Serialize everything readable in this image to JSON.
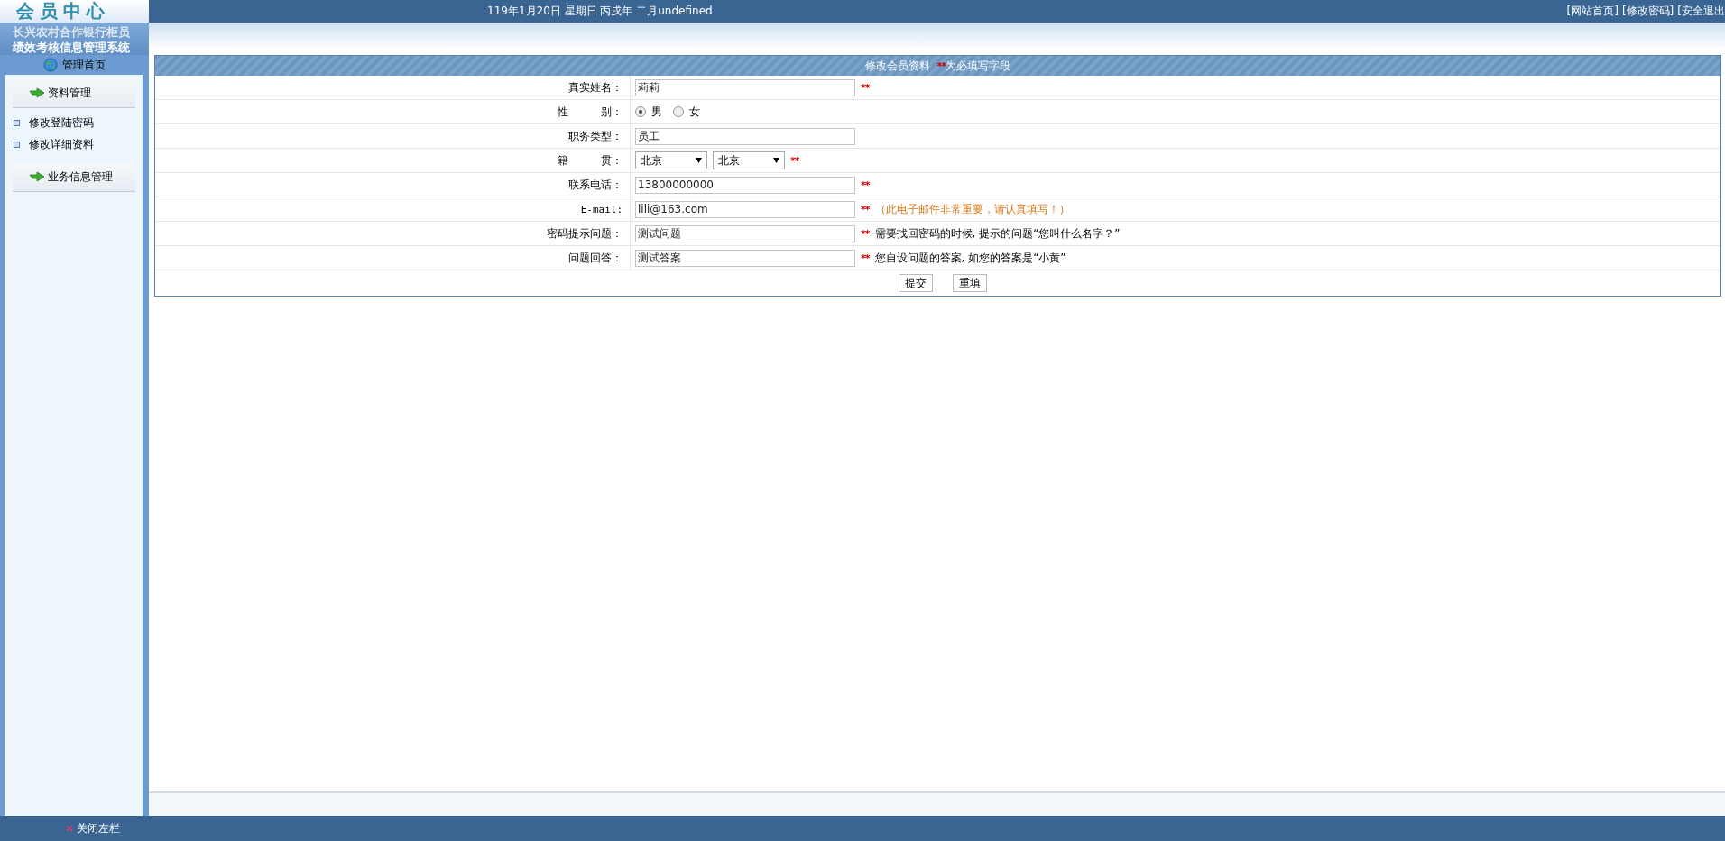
{
  "logo": "会员中心",
  "date_text": "119年1月20日 星期日 丙戌年 二月undefined",
  "top_links": [
    "[网站首页]",
    "[修改密码]",
    "[安全退出"
  ],
  "system_title": [
    "长兴农村合作银行柜员",
    "绩效考核信息管理系统"
  ],
  "home_link": "管理首页",
  "sidebar": {
    "sections": [
      {
        "title": "资料管理",
        "items": [
          "修改登陆密码",
          "修改详细资料"
        ]
      },
      {
        "title": "业务信息管理"
      }
    ]
  },
  "form": {
    "title": "修改会员资料",
    "required_mark": "**",
    "title_suffix": "为必填写字段",
    "rows": [
      {
        "kind": "text",
        "label": "真实姓名：",
        "value": "莉莉",
        "required": true
      },
      {
        "kind": "radio",
        "label": "性　　　别：",
        "options": [
          {
            "label": "男",
            "selected": true
          },
          {
            "label": "女",
            "selected": false
          }
        ]
      },
      {
        "kind": "text",
        "label": "职务类型：",
        "value": "员工",
        "required": false
      },
      {
        "kind": "select",
        "label": "籍　　　贯：",
        "selects": [
          "北京",
          "北京"
        ],
        "required": true
      },
      {
        "kind": "text",
        "label": "联系电话：",
        "value": "13800000000",
        "required": true
      },
      {
        "kind": "text",
        "label": "E-mail:",
        "value": "lili@163.com",
        "required": true,
        "note": "（此电子邮件非常重要，请认真填写！）",
        "warning": true
      },
      {
        "kind": "text",
        "label": "密码提示问题：",
        "value": "测试问题",
        "required": true,
        "note": "需要找回密码的时候, 提示的问题“您叫什么名字？”",
        "warning": false
      },
      {
        "kind": "text",
        "label": "问题回答：",
        "value": "测试答案",
        "required": true,
        "note": "您自设问题的答案, 如您的答案是“小黄”",
        "warning": false
      }
    ],
    "buttons": [
      "提交",
      "重填"
    ]
  },
  "footer": {
    "close_sidebar": "关闭左栏"
  }
}
